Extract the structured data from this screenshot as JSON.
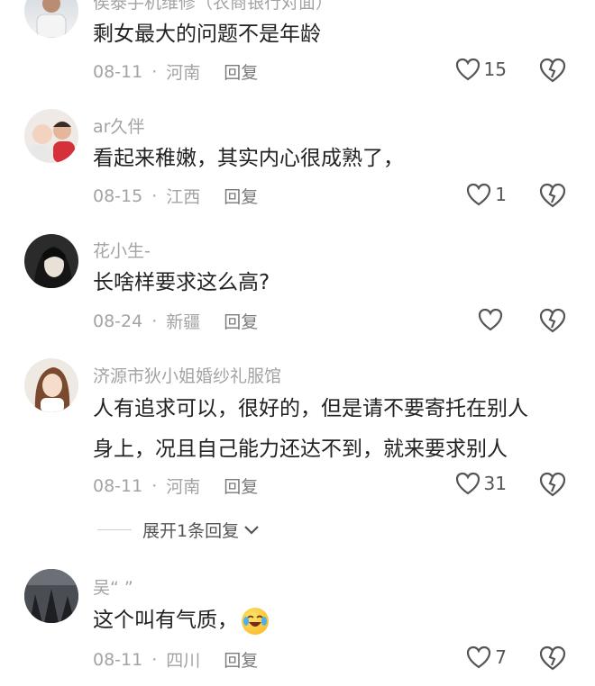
{
  "comments": [
    {
      "username": "侯泰手机维修（农商银行对面）",
      "text": "剩女最大的问题不是年龄",
      "date": "08-11",
      "location": "河南",
      "reply": "回复",
      "likes": "15"
    },
    {
      "username": "ar久伴",
      "text": "看起来稚嫩，其实内心很成熟了，",
      "date": "08-15",
      "location": "江西",
      "reply": "回复",
      "likes": "1"
    },
    {
      "username": "花小生-",
      "text": "长啥样要求这么高?",
      "date": "08-24",
      "location": "新疆",
      "reply": "回复",
      "likes": ""
    },
    {
      "username": "济源市狄小姐婚纱礼服馆",
      "text_line1": "人有追求可以，很好的，但是请不要寄托在别人",
      "text_line2": "身上，况且自己能力还达不到，就来要求别人",
      "date": "08-11",
      "location": "河南",
      "reply": "回复",
      "likes": "31",
      "expand": "展开1条回复"
    },
    {
      "username": "吴“ ”",
      "text": "这个叫有气质，",
      "emoji": "laughing-crying-emoji",
      "date": "08-11",
      "location": "四川",
      "reply": "回复",
      "likes": "7"
    }
  ],
  "meta_separator": "·"
}
